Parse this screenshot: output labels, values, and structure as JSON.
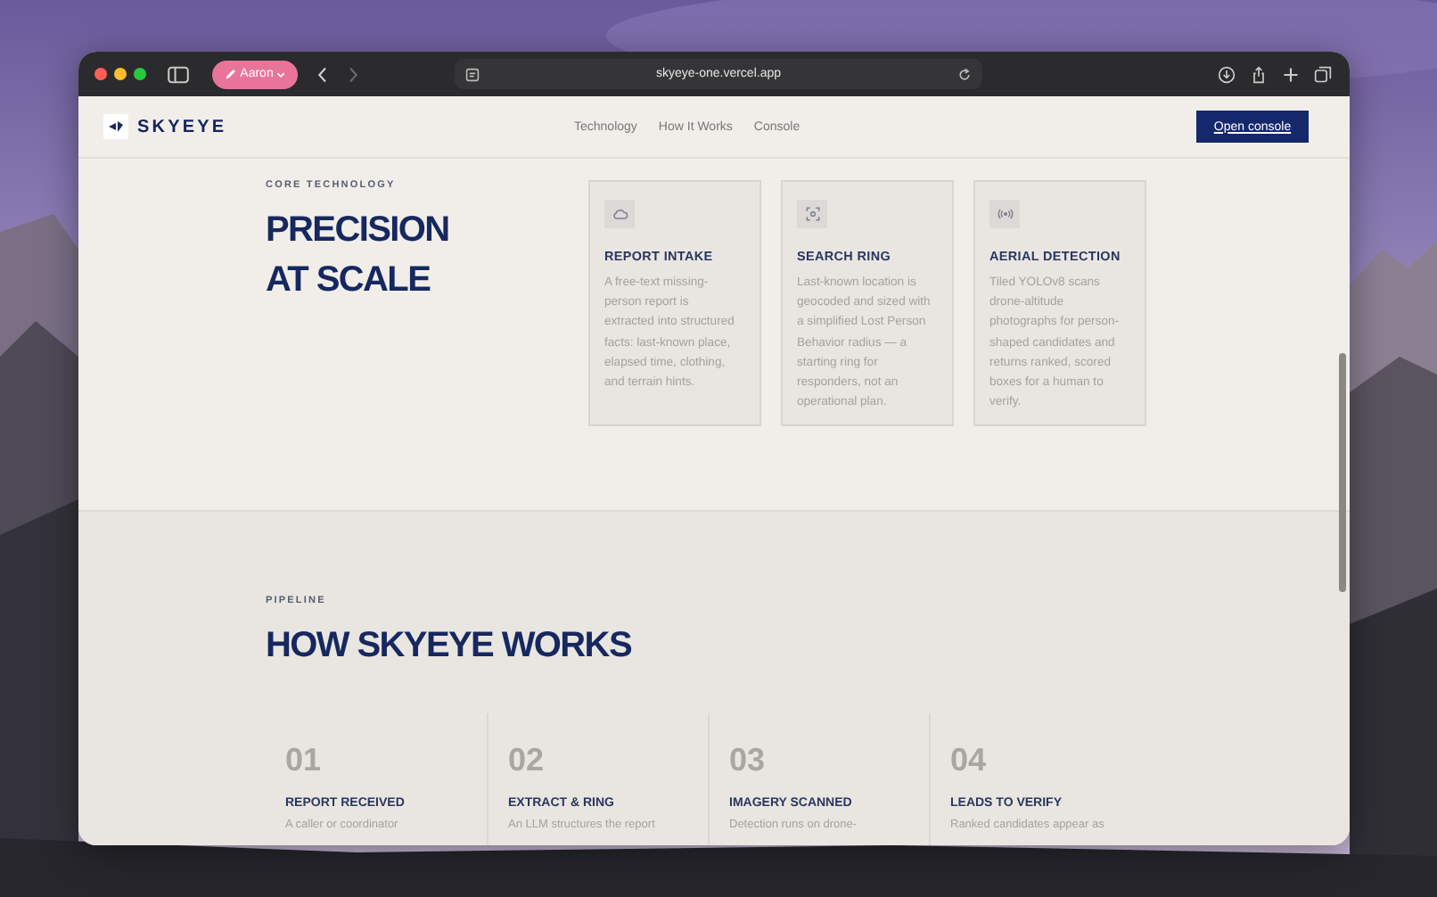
{
  "browser": {
    "profile": "Aaron",
    "url": "skyeye-one.vercel.app"
  },
  "site": {
    "logo": "SKYEYE",
    "nav": [
      "Technology",
      "How It Works",
      "Console"
    ],
    "cta": "Open console"
  },
  "technology": {
    "eyebrow": "CORE TECHNOLOGY",
    "title_lines": [
      "PRECISION",
      "AT SCALE"
    ],
    "cards": [
      {
        "kind": "cloud",
        "title": "REPORT INTAKE",
        "text": "A free-text missing-person report is extracted into structured facts: last-known place, elapsed time, clothing, and terrain hints."
      },
      {
        "kind": "scan",
        "title": "SEARCH RING",
        "text": "Last-known location is geocoded and sized with a simplified Lost Person Behavior radius — a starting ring for responders, not an operational plan."
      },
      {
        "kind": "signal",
        "title": "AERIAL DETECTION",
        "text": "Tiled YOLOv8 scans drone-altitude photographs for person-shaped candidates and returns ranked, scored boxes for a human to verify."
      }
    ]
  },
  "pipeline": {
    "eyebrow": "PIPELINE",
    "title": "HOW SKYEYE WORKS",
    "steps": [
      {
        "number": "01",
        "title": "REPORT RECEIVED",
        "text": "A caller or coordinator"
      },
      {
        "number": "02",
        "title": "EXTRACT & RING",
        "text": "An LLM structures the report"
      },
      {
        "number": "03",
        "title": "IMAGERY SCANNED",
        "text": "Detection runs on drone-"
      },
      {
        "number": "04",
        "title": "LEADS TO VERIFY",
        "text": "Ranked candidates appear as"
      }
    ]
  }
}
